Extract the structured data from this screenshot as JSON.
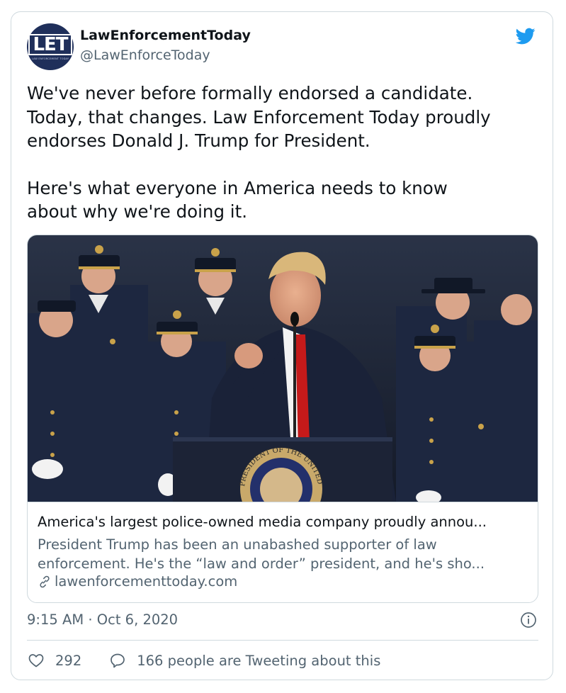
{
  "author": {
    "display_name": "LawEnforcementToday",
    "handle": "@LawEnforceToday",
    "avatar_monogram": "LET",
    "avatar_caption": "LAW ENFORCEMENT TODAY"
  },
  "tweet": {
    "lines": [
      "We've never before formally endorsed a candidate.",
      "Today, that changes.  Law Enforcement Today proudly",
      "endorses Donald J. Trump for President.",
      "Here's what everyone in America needs to know",
      "about why we're doing it."
    ]
  },
  "link_card": {
    "title": "America's largest police-owned media company proudly annou...",
    "description_lines": [
      "President Trump has been an unabashed supporter of law",
      "enforcement. He's the “law and order” president, and he's sho..."
    ],
    "domain": "lawenforcementtoday.com",
    "seal_text": "PRESIDENT OF THE UNITED"
  },
  "meta": {
    "time": "9:15 AM · Oct 6, 2020"
  },
  "stats": {
    "likes": "292",
    "conversation": "166 people are Tweeting about this"
  },
  "icons": {
    "brand": "twitter-bird-icon",
    "info": "info-icon",
    "link": "link-icon",
    "like": "heart-icon",
    "reply": "reply-bubble-icon"
  },
  "colors": {
    "twitter_blue": "#1d9bf0",
    "secondary_text": "#536471",
    "border": "#cfd9de",
    "avatar_bg": "#1f2f5a"
  }
}
